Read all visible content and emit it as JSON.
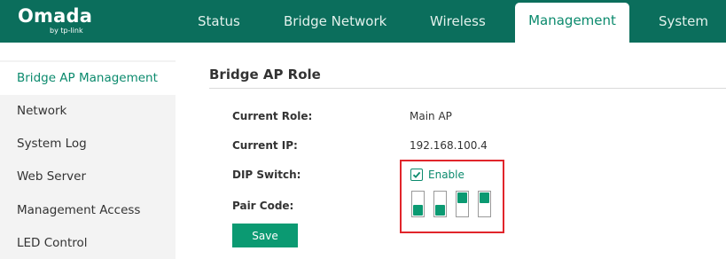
{
  "app": {
    "logo_text": "Omada",
    "logo_sub": "by tp-link"
  },
  "nav": {
    "tabs": [
      {
        "label": "Status",
        "active": false
      },
      {
        "label": "Bridge Network",
        "active": false
      },
      {
        "label": "Wireless",
        "active": false
      },
      {
        "label": "Management",
        "active": true
      },
      {
        "label": "System",
        "active": false
      }
    ]
  },
  "sidebar": {
    "items": [
      {
        "label": "Bridge AP Management",
        "active": true
      },
      {
        "label": "Network",
        "active": false
      },
      {
        "label": "System Log",
        "active": false
      },
      {
        "label": "Web Server",
        "active": false
      },
      {
        "label": "Management Access",
        "active": false
      },
      {
        "label": "LED Control",
        "active": false
      }
    ]
  },
  "main": {
    "title": "Bridge AP Role",
    "fields": {
      "current_role": {
        "label": "Current Role:",
        "value": "Main AP"
      },
      "current_ip": {
        "label": "Current IP:",
        "value": "192.168.100.4"
      },
      "dip_switch": {
        "label": "DIP Switch:",
        "enable_label": "Enable",
        "enabled": true
      },
      "pair_code": {
        "label": "Pair Code:",
        "switches": [
          "down",
          "down",
          "up",
          "up"
        ]
      }
    },
    "save_label": "Save"
  },
  "colors": {
    "header_bg": "#0b6e5c",
    "accent": "#0b8a6d",
    "button": "#0b9a72",
    "highlight_border": "#e1252b"
  }
}
